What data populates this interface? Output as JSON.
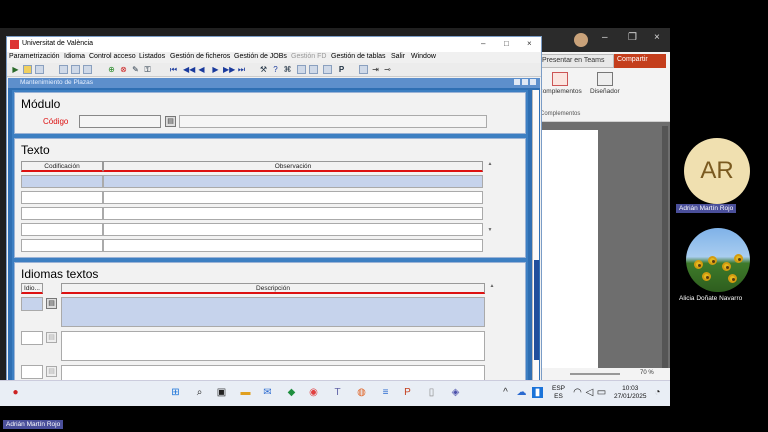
{
  "ppt": {
    "present_teams": "Presentar en Teams",
    "share": "Compartir",
    "complements": "Complementos",
    "designer": "Diseñador",
    "section": "Complementos",
    "zoom": "70 %"
  },
  "window": {
    "title": "Universitat de València",
    "minimize": "–",
    "maximize": "□",
    "close": "×"
  },
  "menu": [
    {
      "label": "Parametrización",
      "enabled": true
    },
    {
      "label": "Idioma",
      "enabled": true
    },
    {
      "label": "Control acceso",
      "enabled": true
    },
    {
      "label": "Listados",
      "enabled": true
    },
    {
      "label": "Gestión de ficheros",
      "enabled": true
    },
    {
      "label": "Gestión de JOBs",
      "enabled": true
    },
    {
      "label": "Gestión FD",
      "enabled": false
    },
    {
      "label": "Gestión de tablas",
      "enabled": true
    },
    {
      "label": "Salir",
      "enabled": true
    },
    {
      "label": "Window",
      "enabled": true
    }
  ],
  "form": {
    "title": "Mantenimiento de Plazas",
    "modulo": {
      "heading": "Módulo",
      "codigo_label": "Código",
      "codigo_value": "",
      "descripcion_value": ""
    },
    "texto": {
      "heading": "Texto",
      "col_codificacion": "Codificación",
      "col_observacion": "Observación"
    },
    "idiomas": {
      "heading": "Idiomas textos",
      "col_idioma": "Idio...",
      "col_descripcion": "Descripción"
    }
  },
  "participants": [
    {
      "initials": "AR",
      "name": "Adrián Martín Rojo"
    },
    {
      "name": "Alicia Doñate Navarro"
    }
  ],
  "tray": {
    "lang": "ESP",
    "lang2": "ES",
    "time": "10:03",
    "date": "27/01/2025"
  },
  "bottom_tag": "Adrián Martín Rojo"
}
